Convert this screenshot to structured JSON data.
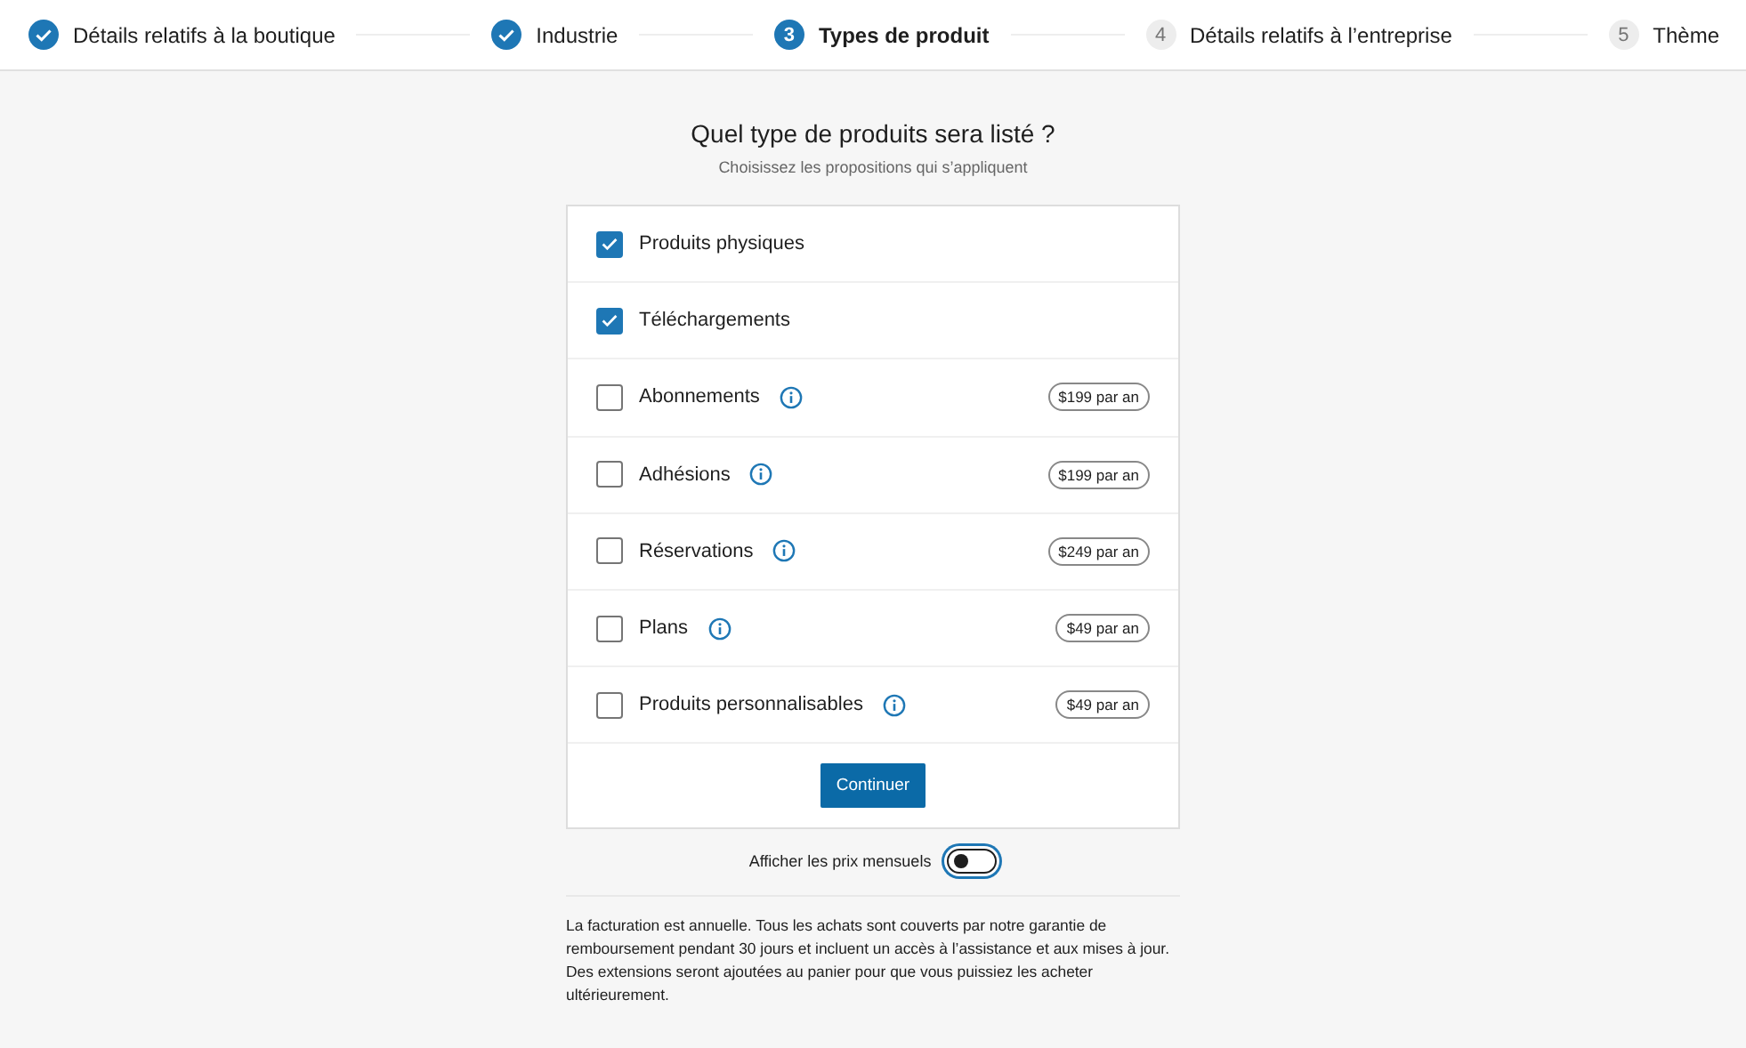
{
  "steps": [
    {
      "label": "Détails relatifs à la boutique",
      "completed": true,
      "selected": false
    },
    {
      "label": "Industrie",
      "completed": true,
      "selected": false
    },
    {
      "number": "3",
      "label": "Types de produit",
      "completed": false,
      "selected": true
    },
    {
      "number": "4",
      "label": "Détails relatifs à l’entreprise",
      "completed": false,
      "selected": false
    },
    {
      "number": "5",
      "label": "Thème",
      "completed": false,
      "selected": false
    }
  ],
  "heading": "Quel type de produits sera listé ?",
  "subheading": "Choisissez les propositions qui s’appliquent",
  "options": [
    {
      "label": "Produits physiques",
      "checked": true,
      "info": false
    },
    {
      "label": "Téléchargements",
      "checked": true,
      "info": false
    },
    {
      "label": "Abonnements",
      "checked": false,
      "info": true,
      "price": "$199 par an"
    },
    {
      "label": "Adhésions",
      "checked": false,
      "info": true,
      "price": "$199 par an"
    },
    {
      "label": "Réservations",
      "checked": false,
      "info": true,
      "price": "$249 par an"
    },
    {
      "label": "Plans",
      "checked": false,
      "info": true,
      "price": "$49 par an"
    },
    {
      "label": "Produits personnalisables",
      "checked": false,
      "info": true,
      "price": "$49 par an"
    }
  ],
  "continue_button": "Continuer",
  "monthly_toggle": {
    "label": "Afficher les prix mensuels",
    "on": false
  },
  "footnote": "La facturation est annuelle. Tous les achats sont couverts par notre garantie de remboursement pendant 30 jours et incluent un accès à l’assistance et aux mises à jour. Des extensions seront ajoutées au panier pour que vous puissiez les acheter ultérieurement."
}
